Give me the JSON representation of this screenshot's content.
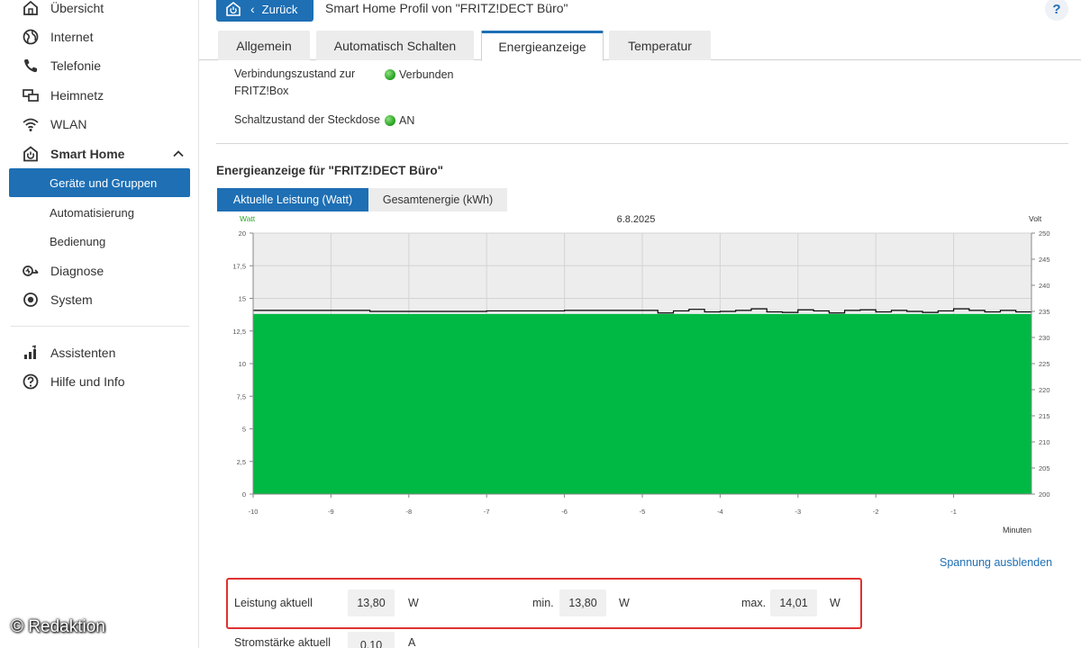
{
  "sidebar": {
    "items": [
      {
        "label": "Übersicht",
        "icon": "home-icon"
      },
      {
        "label": "Internet",
        "icon": "globe-icon"
      },
      {
        "label": "Telefonie",
        "icon": "phone-icon"
      },
      {
        "label": "Heimnetz",
        "icon": "network-icon"
      },
      {
        "label": "WLAN",
        "icon": "wifi-icon"
      },
      {
        "label": "Smart Home",
        "icon": "smart-home-icon",
        "expanded": true
      },
      {
        "label": "Diagnose",
        "icon": "diagnose-icon"
      },
      {
        "label": "System",
        "icon": "system-icon"
      },
      {
        "label": "Assistenten",
        "icon": "assistant-icon"
      },
      {
        "label": "Hilfe und Info",
        "icon": "help-circle-icon"
      }
    ],
    "sub_items": [
      {
        "label": "Geräte und Gruppen",
        "active": true
      },
      {
        "label": "Automatisierung",
        "active": false
      },
      {
        "label": "Bedienung",
        "active": false
      }
    ],
    "watermark": "© Redaktion"
  },
  "header": {
    "back_label": "Zurück",
    "title": "Smart Home Profil von \"FRITZ!DECT Büro\"",
    "help": "?"
  },
  "tabs": [
    {
      "label": "Allgemein",
      "active": false
    },
    {
      "label": "Automatisch Schalten",
      "active": false
    },
    {
      "label": "Energieanzeige",
      "active": true
    },
    {
      "label": "Temperatur",
      "active": false
    }
  ],
  "status": {
    "connection_label_1": "Verbindungszustand zur",
    "connection_label_2": "FRITZ!Box",
    "connection_value": "Verbunden",
    "switch_label": "Schaltzustand der Steckdose",
    "switch_value": "AN",
    "indicator_color": "#2ea82a"
  },
  "energy": {
    "section_title": "Energieanzeige für \"FRITZ!DECT Büro\"",
    "subtabs": [
      {
        "label": "Aktuelle Leistung (Watt)",
        "active": true
      },
      {
        "label": "Gesamtenergie (kWh)",
        "active": false
      }
    ],
    "toggle_link": "Spannung ausblenden"
  },
  "chart_data": {
    "type": "area",
    "title": "6.8.2025",
    "ylabel": "Watt",
    "y2label": "Volt",
    "xlabel": "Minuten",
    "ylim": [
      0,
      20
    ],
    "y2lim": [
      200,
      250
    ],
    "xlim": [
      -10,
      0
    ],
    "x_ticks": [
      -10,
      -9,
      -8,
      -7,
      -6,
      -5,
      -4,
      -3,
      -2,
      -1
    ],
    "y_ticks": [
      0,
      2.5,
      5,
      7.5,
      10,
      12.5,
      15,
      17.5,
      20
    ],
    "y2_ticks": [
      200,
      205,
      210,
      215,
      220,
      225,
      230,
      235,
      240,
      245,
      250
    ],
    "grid": true,
    "series": [
      {
        "name": "Watt",
        "color": "#00b944",
        "x": [
          -10,
          -5,
          -4.5,
          -4,
          -3.5,
          -3,
          -2.5,
          -2,
          -1.5,
          -1,
          -0.5,
          0
        ],
        "values": [
          13.8,
          13.8,
          13.8,
          13.8,
          13.8,
          13.8,
          13.8,
          13.8,
          13.8,
          13.8,
          13.8,
          13.8
        ]
      },
      {
        "name": "Volt",
        "color": "#000000",
        "x": [
          -10,
          -9.5,
          -9,
          -8.5,
          -8,
          -7.5,
          -7,
          -6.5,
          -6,
          -5.5,
          -5,
          -4.8,
          -4.6,
          -4.4,
          -4.2,
          -4,
          -3.8,
          -3.6,
          -3.4,
          -3.2,
          -3,
          -2.8,
          -2.6,
          -2.4,
          -2.2,
          -2,
          -1.8,
          -1.6,
          -1.4,
          -1.2,
          -1,
          -0.8,
          -0.6,
          -0.4,
          -0.2,
          0
        ],
        "values": [
          235.2,
          235.2,
          235.2,
          235.0,
          235.0,
          235.0,
          235.1,
          235.1,
          235.2,
          235.2,
          235.2,
          234.7,
          235.1,
          235.4,
          234.9,
          235.0,
          235.2,
          235.5,
          234.9,
          234.8,
          235.3,
          235.1,
          234.7,
          235.2,
          235.3,
          234.9,
          235.2,
          235.0,
          234.8,
          235.1,
          235.5,
          235.2,
          234.9,
          235.2,
          234.9,
          235.0
        ]
      }
    ]
  },
  "values": {
    "power_label": "Leistung aktuell",
    "power_value": "13,80",
    "power_unit": "W",
    "min_label": "min.",
    "min_value": "13,80",
    "min_unit": "W",
    "max_label": "max.",
    "max_value": "14,01",
    "max_unit": "W",
    "current_label": "Stromstärke aktuell",
    "current_value": "0,10",
    "current_unit": "A"
  }
}
